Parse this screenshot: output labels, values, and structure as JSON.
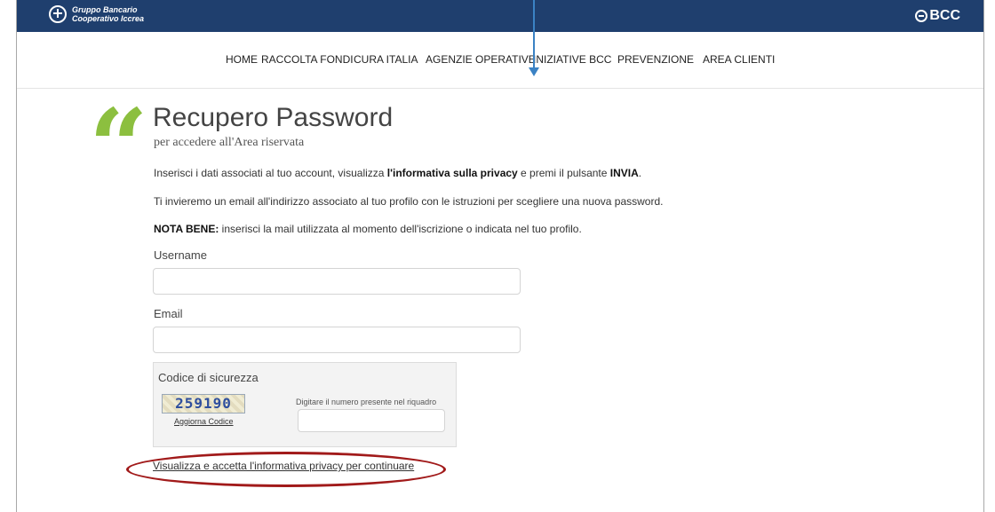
{
  "header": {
    "brand_left": "Gruppo Bancario Cooperativo Iccrea",
    "brand_right": "BCC",
    "bar_color": "#1f3f6e"
  },
  "nav": {
    "items": [
      {
        "label": "HOME"
      },
      {
        "label": "RACCOLTA FONDI"
      },
      {
        "label": "CURA ITALIA"
      },
      {
        "label": "AGENZIE OPERATIVE"
      },
      {
        "label": "INIZIATIVE BCC"
      },
      {
        "label": "PREVENZIONE"
      },
      {
        "label": "AREA CLIENTI"
      }
    ]
  },
  "page": {
    "title": "Recupero Password",
    "subtitle": "per accedere all'Area riservata",
    "accent_color": "#8cbf3f",
    "intro": {
      "text1": "Inserisci i dati associati al tuo account, visualizza ",
      "bold1": "l'informativa sulla privacy",
      "text2": " e premi il pulsante ",
      "bold2": "INVIA",
      "text3": "."
    },
    "line2": "Ti invieremo un email all'indirizzo associato al tuo profilo con le istruzioni per scegliere una nuova password.",
    "note": {
      "bold": "NOTA BENE:",
      "text": " inserisci la mail utilizzata al momento dell'iscrizione o indicata nel tuo profilo."
    }
  },
  "form": {
    "username_label": "Username",
    "username_value": "",
    "email_label": "Email",
    "email_value": "",
    "captcha": {
      "title": "Codice di sicurezza",
      "code_image_text": "259190",
      "refresh_label": "Aggiorna Codice",
      "hint": "Digitare il numero presente nel riquadro",
      "value": ""
    },
    "privacy_link": "Visualizza e accetta l'informativa privacy per continuare"
  },
  "annotations": {
    "arrow_color": "#3b82c4",
    "ellipse_color": "#a11a1a"
  }
}
